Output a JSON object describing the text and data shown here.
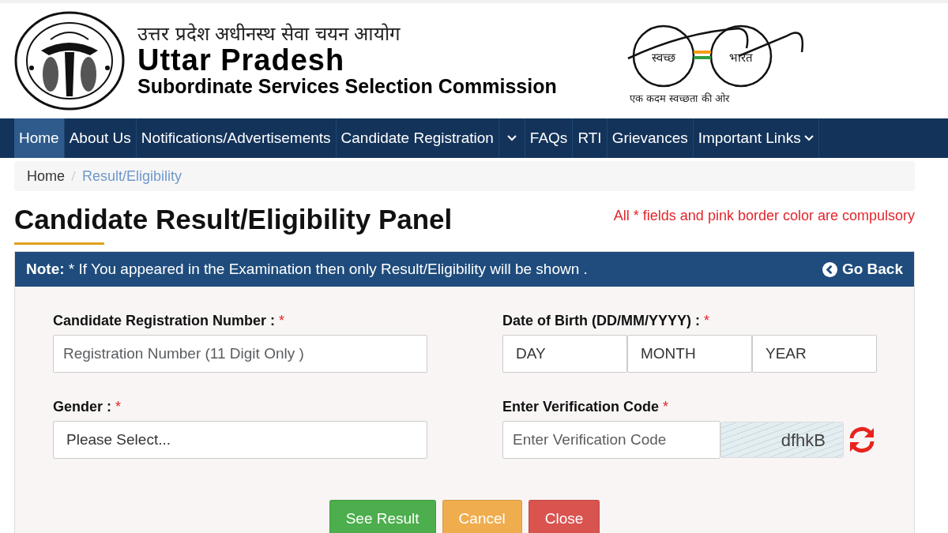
{
  "header": {
    "hindi_title": "उत्तर प्रदेश अधीनस्थ सेवा चयन आयोग",
    "title": "Uttar Pradesh",
    "subtitle": "Subordinate Services Selection Commission"
  },
  "swachh_logo": {
    "left_word": "स्वच्छ",
    "right_word": "भारत",
    "tagline": "एक कदम स्वच्छता की ओर"
  },
  "nav": [
    {
      "label": "Home",
      "selected": true,
      "kind": "link"
    },
    {
      "label": "About Us",
      "selected": false,
      "kind": "link"
    },
    {
      "label": "Notifications/Advertisements",
      "selected": false,
      "kind": "link"
    },
    {
      "label": "Candidate Registration",
      "selected": false,
      "kind": "split"
    },
    {
      "label": "FAQs",
      "selected": false,
      "kind": "link"
    },
    {
      "label": "RTI",
      "selected": false,
      "kind": "link"
    },
    {
      "label": "Grievances",
      "selected": false,
      "kind": "link"
    },
    {
      "label": "Important Links",
      "selected": false,
      "kind": "dropdown"
    }
  ],
  "breadcrumb": [
    {
      "label": "Home",
      "current": false
    },
    {
      "label": "Result/Eligibility",
      "current": true
    }
  ],
  "page_title": "Candidate Result/Eligibility Panel",
  "required_note": "All * fields and pink border color are compulsory",
  "panel": {
    "note_label": "Note:",
    "note_text": "* If You appeared in the Examination then only Result/Eligibility will be shown .",
    "back_button": "Go Back"
  },
  "fields": [
    {
      "kind": "text",
      "label": "Candidate Registration Number :",
      "required": "*",
      "placeholder": "Registration Number (11 Digit Only )"
    },
    {
      "kind": "date",
      "label": "Date of Birth (DD/MM/YYYY) :",
      "required": "*",
      "parts": [
        "DAY",
        "MONTH",
        "YEAR"
      ]
    },
    {
      "kind": "select",
      "label": "Gender :",
      "required": "*",
      "value": "Please Select..."
    },
    {
      "kind": "captcha",
      "label": "Enter Verification Code",
      "required": "*",
      "placeholder": "Enter Verification Code",
      "code": "dfhkB"
    }
  ],
  "buttons": [
    {
      "label": "See Result",
      "color": "#4cae4c"
    },
    {
      "label": "Cancel",
      "color": "#efad4e"
    },
    {
      "label": "Close",
      "color": "#d9534f"
    }
  ]
}
